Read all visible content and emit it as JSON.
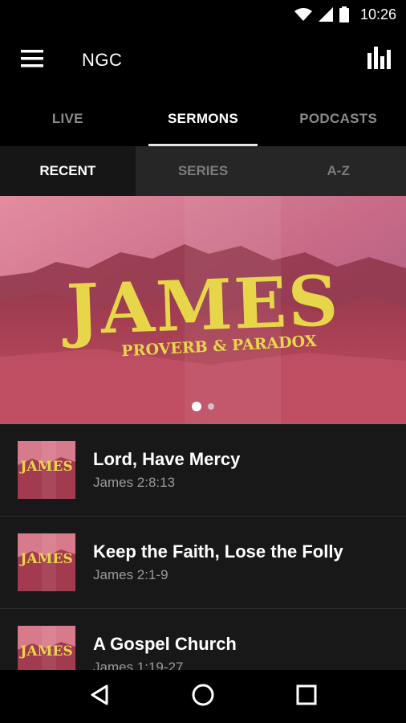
{
  "status_bar": {
    "time": "10:26"
  },
  "app_bar": {
    "title": "NGC"
  },
  "tabs": [
    {
      "label": "LIVE",
      "active": false
    },
    {
      "label": "SERMONS",
      "active": true
    },
    {
      "label": "PODCASTS",
      "active": false
    }
  ],
  "subtabs": [
    {
      "label": "RECENT",
      "active": true
    },
    {
      "label": "SERIES",
      "active": false
    },
    {
      "label": "A-Z",
      "active": false
    }
  ],
  "hero": {
    "title": "JAMES",
    "subtitle": "PROVERB & PARADOX",
    "page_count": 2,
    "current_page": 1
  },
  "sermons": [
    {
      "title": "Lord, Have Mercy",
      "reference": "James 2:8:13",
      "thumb_text": "JAMES"
    },
    {
      "title": "Keep the Faith, Lose the Folly",
      "reference": "James 2:1-9",
      "thumb_text": "JAMES"
    },
    {
      "title": "A Gospel Church",
      "reference": "James 1:19-27",
      "thumb_text": "JAMES"
    }
  ],
  "colors": {
    "accent_title": "#e8d64a",
    "hero_pink": "#c24f63",
    "background": "#181818"
  }
}
